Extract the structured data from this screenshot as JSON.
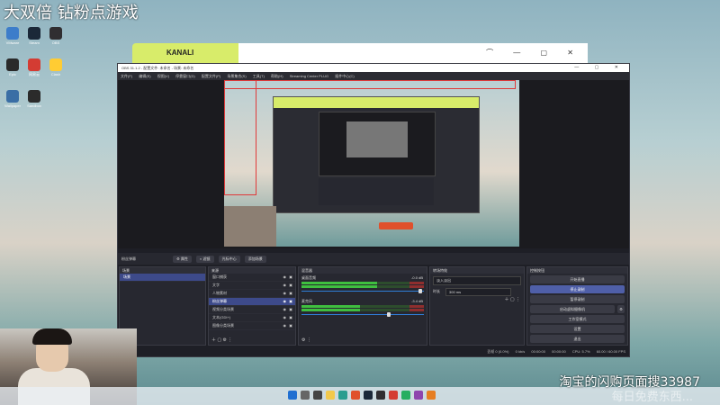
{
  "overlay": {
    "title": "大双倍 钻粉点游戏",
    "bottom_line1": "淘宝的闪购页面搜33987",
    "bottom_line2": "每日免费东西..."
  },
  "desktop_icons": [
    {
      "label": "VMware",
      "color": "#3d7dca"
    },
    {
      "label": "Steam",
      "color": "#1b2838"
    },
    {
      "label": "OBS",
      "color": "#302e31"
    },
    {
      "label": "Epic",
      "color": "#2a2a2a"
    },
    {
      "label": "网易云",
      "color": "#d43c33"
    },
    {
      "label": "Clash",
      "color": "#ffcc33"
    },
    {
      "label": "Wallpaper",
      "color": "#3a6ea5"
    },
    {
      "label": "Sandbox",
      "color": "#2b2b2b"
    }
  ],
  "kanali": {
    "brand": "KANALI"
  },
  "obs": {
    "window_title": "OBS 31.1.2 - 配置文件: 未命名 - 场景: 未命名",
    "menu": [
      "文件(F)",
      "编辑(E)",
      "视图(V)",
      "停靠窗口(D)",
      "配置文件(P)",
      "场景集合(S)",
      "工具(T)",
      "帮助(H)",
      "Streaming Center PLUG",
      "插件中心(C)"
    ],
    "source_bar": {
      "current_source": "粉丝弹幕",
      "props": "属性",
      "filter": "滤镜",
      "cursor_scene": "光标中心",
      "add_scene": "添加场景"
    },
    "docks": {
      "scenes": {
        "title": "场景",
        "items": [
          "场景"
        ]
      },
      "sources": {
        "title": "来源",
        "items": [
          "窗口捕获",
          "文字",
          "人物素材",
          "粉丝弹幕",
          "视频分类场景",
          "文本(GDI+)",
          "图像分类场景"
        ]
      },
      "mixer": {
        "title": "混音器",
        "channels": [
          {
            "name": "桌面音频",
            "level_db": "-0.0 dB",
            "level_fraction": 0.62
          },
          {
            "name": "麦克风",
            "level_db": "-3.4 dB",
            "level_fraction": 0.48
          }
        ]
      },
      "transitions": {
        "title": "转场特效",
        "type": "淡入淡出",
        "duration_label": "时长",
        "duration": "300 ms"
      },
      "controls": {
        "title": "控制按钮",
        "buttons": [
          "开始直播",
          "停止录制",
          "暂停录制",
          "启动虚拟摄像机",
          "工作室模式",
          "设置",
          "退出"
        ]
      }
    },
    "status": {
      "cpu": "CPU: 5.7%",
      "fps": "60.00 / 60.00 FPS",
      "time1": "00:00:00",
      "time2": "00:00:00",
      "kbps": "0 kb/s",
      "dropped": "丢帧 0 (0.0%)"
    }
  },
  "taskbar": {
    "icons": [
      "start",
      "search",
      "task",
      "explorer",
      "edge",
      "store",
      "steam",
      "obs",
      "music",
      "chat",
      "game",
      "browser"
    ]
  }
}
